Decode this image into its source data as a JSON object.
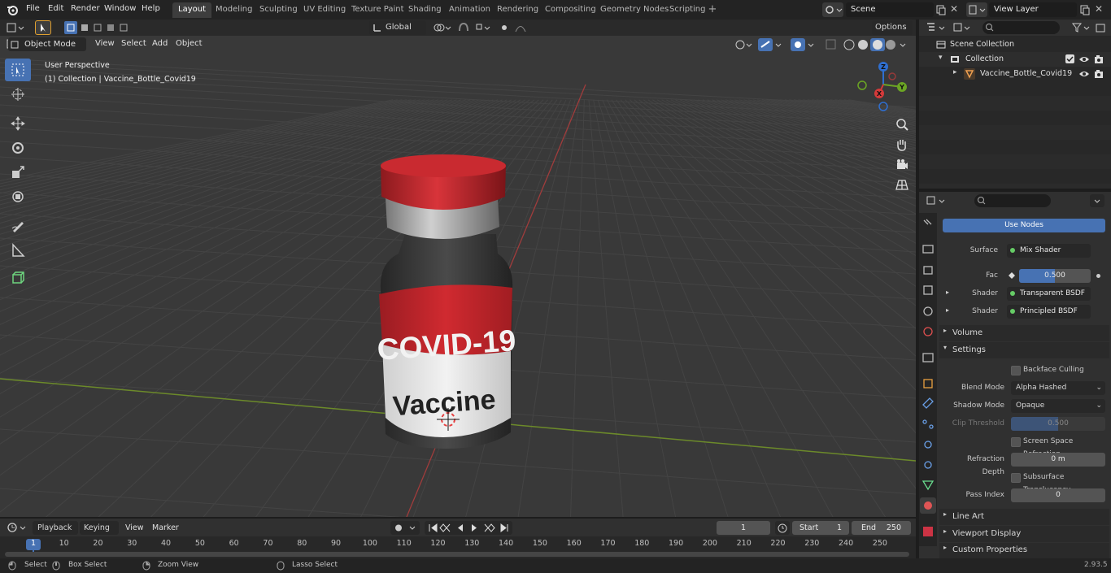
{
  "topbar": {
    "menus": [
      "File",
      "Edit",
      "Render",
      "Window",
      "Help"
    ],
    "workspaces": [
      "Layout",
      "Modeling",
      "Sculpting",
      "UV Editing",
      "Texture Paint",
      "Shading",
      "Animation",
      "Rendering",
      "Compositing",
      "Geometry Nodes",
      "Scripting"
    ],
    "active_workspace": "Layout",
    "add_tab": "+",
    "scene": "Scene",
    "view_layer": "View Layer"
  },
  "viewport": {
    "mode": "Object Mode",
    "menus": [
      "View",
      "Select",
      "Add",
      "Object"
    ],
    "orientation": "Global",
    "options": "Options",
    "perspective": "User Perspective",
    "collection_path": "(1) Collection | Vaccine_Bottle_Covid19",
    "label_top": "COVID-19",
    "label_bottom": "Vaccine",
    "gizmo": {
      "z": "Z",
      "y": "Y",
      "x": "X"
    }
  },
  "outliner": {
    "scene_collection": "Scene Collection",
    "collection": "Collection",
    "object": "Vaccine_Bottle_Covid19"
  },
  "properties": {
    "use_nodes": "Use Nodes",
    "surface_label": "Surface",
    "surface_value": "Mix Shader",
    "fac_label": "Fac",
    "fac_value": "0.500",
    "fac_fraction": 0.5,
    "shader1_label": "Shader",
    "shader1_value": "Transparent BSDF",
    "shader2_label": "Shader",
    "shader2_value": "Principled BSDF",
    "volume": "Volume",
    "settings": "Settings",
    "backface": "Backface Culling",
    "blend_label": "Blend Mode",
    "blend_value": "Alpha Hashed",
    "shadow_label": "Shadow Mode",
    "shadow_value": "Opaque",
    "clip_label": "Clip Threshold",
    "clip_value": "0.500",
    "ssr": "Screen Space Refraction",
    "refraction_label": "Refraction Depth",
    "refraction_value": "0 m",
    "subsurface": "Subsurface Translucency",
    "pass_label": "Pass Index",
    "pass_value": "0",
    "line_art": "Line Art",
    "viewport_display": "Viewport Display",
    "custom_properties": "Custom Properties"
  },
  "timeline": {
    "menus": [
      "Playback",
      "Keying",
      "View",
      "Marker"
    ],
    "current_frame": "1",
    "start_label": "Start",
    "start_value": "1",
    "end_label": "End",
    "end_value": "250",
    "ticks": [
      "1",
      "10",
      "20",
      "30",
      "40",
      "50",
      "60",
      "70",
      "80",
      "90",
      "100",
      "110",
      "120",
      "130",
      "140",
      "150",
      "160",
      "170",
      "180",
      "190",
      "200",
      "210",
      "220",
      "230",
      "240",
      "250"
    ]
  },
  "statusbar": {
    "select": "Select",
    "box_select": "Box Select",
    "zoom_view": "Zoom View",
    "lasso_select": "Lasso Select",
    "version": "2.93.5"
  },
  "colors": {
    "accent": "#4772b3",
    "x_axis": "#e4383f",
    "y_axis": "#86b818",
    "cap_red": "#c8262c"
  }
}
